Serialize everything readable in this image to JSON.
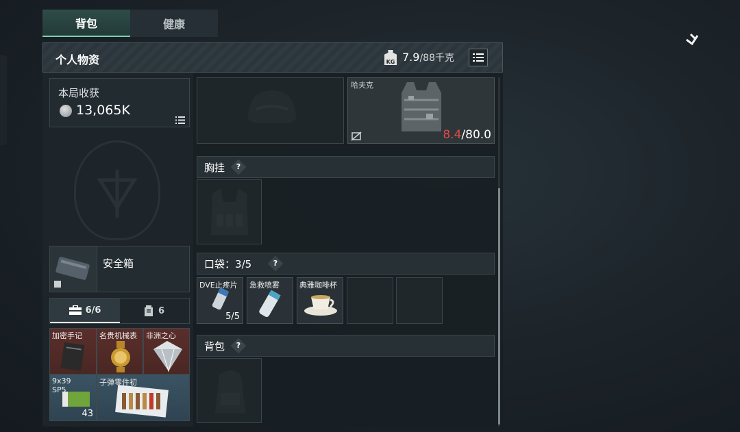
{
  "tabs": [
    {
      "label": "背包"
    },
    {
      "label": "健康"
    }
  ],
  "header": {
    "title": "个人物资",
    "weight_current": "7.9",
    "weight_max": "/88千克",
    "kg_icon": "KG"
  },
  "loot_card": {
    "title": "本局收获",
    "value": "13,065K"
  },
  "safe_box": {
    "label": "安全箱"
  },
  "subtabs": [
    {
      "icon": "briefcase-icon",
      "label": "6/6"
    },
    {
      "icon": "canister-icon",
      "label": "6"
    }
  ],
  "safe_items": [
    {
      "label": "加密手记",
      "style": "red"
    },
    {
      "label": "名贵机械表",
      "style": "red"
    },
    {
      "label": "非洲之心",
      "style": "red"
    },
    {
      "label": "9x39 SP5",
      "count": "43",
      "style": "blue"
    },
    {
      "label": "子弹零件初",
      "style": "blue"
    }
  ],
  "armor": {
    "name": "哈夫克",
    "durability_current": "8.4",
    "durability_max": "/80.0"
  },
  "sections": {
    "chest": "胸挂",
    "pockets_label": "口袋",
    "pockets_count": "3/5",
    "backpack": "背包",
    "help": "?"
  },
  "pockets": [
    {
      "label": "DVE止疼片",
      "count": "5/5"
    },
    {
      "label": "急救喷雾",
      "count": ""
    },
    {
      "label": "典雅咖啡杯",
      "count": ""
    }
  ],
  "colors": {
    "accent": "#7ed0b0",
    "durability_low": "#e04a4a",
    "rare_red": "#5a2e2a",
    "ammo_blue": "#3a5362"
  }
}
